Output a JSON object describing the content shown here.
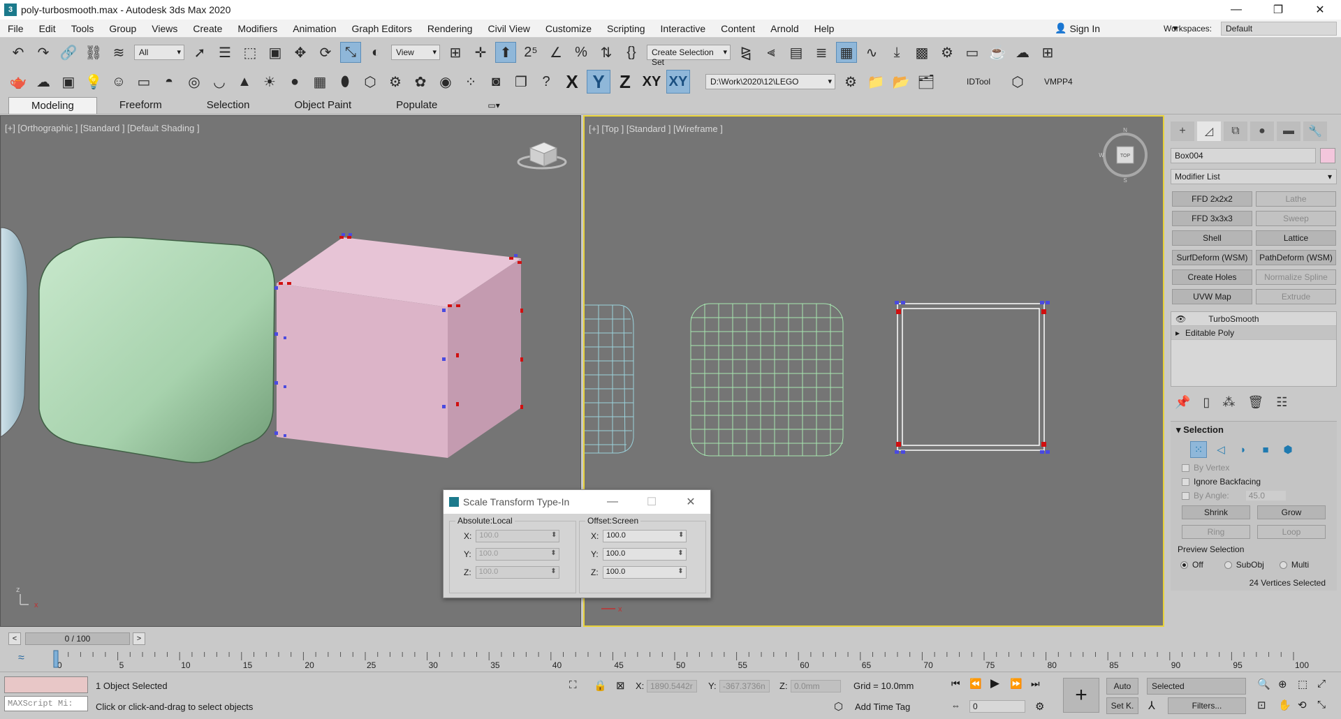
{
  "titlebar": {
    "title": "poly-turbosmooth.max - Autodesk 3ds Max 2020",
    "min": "—",
    "max": "❐",
    "close": "✕"
  },
  "menu": [
    "File",
    "Edit",
    "Tools",
    "Group",
    "Views",
    "Create",
    "Modifiers",
    "Animation",
    "Graph Editors",
    "Rendering",
    "Civil View",
    "Customize",
    "Scripting",
    "Interactive",
    "Content",
    "Arnold",
    "Help"
  ],
  "signin": "Sign In",
  "workspaces": {
    "label": "Workspaces:",
    "value": "Default"
  },
  "toolbar1": {
    "filter": "All",
    "refcoord": "View",
    "selset": "Create Selection Set"
  },
  "toolbar2": {
    "path": "D:\\Work\\2020\\12\\LEGO",
    "idtool": "IDTool",
    "vmpp": "VMPP4",
    "axis": [
      "X",
      "Y",
      "Z",
      "XY",
      "XY"
    ]
  },
  "ribbon_tabs": [
    "Modeling",
    "Freeform",
    "Selection",
    "Object Paint",
    "Populate"
  ],
  "viewport_left": {
    "label": "[+] [Orthographic ] [Standard ] [Default Shading ]"
  },
  "viewport_right": {
    "label": "[+] [Top ] [Standard ] [Wireframe ]"
  },
  "command_panel": {
    "object_name": "Box004",
    "modifier_list": "Modifier List",
    "modifiers": [
      {
        "label": "FFD 2x2x2",
        "enabled": true
      },
      {
        "label": "Lathe",
        "enabled": false
      },
      {
        "label": "FFD 3x3x3",
        "enabled": true
      },
      {
        "label": "Sweep",
        "enabled": false
      },
      {
        "label": "Shell",
        "enabled": true
      },
      {
        "label": "Lattice",
        "enabled": true
      },
      {
        "label": "SurfDeform (WSM)",
        "enabled": true
      },
      {
        "label": "PathDeform (WSM)",
        "enabled": true
      },
      {
        "label": "Create Holes",
        "enabled": true
      },
      {
        "label": "Normalize Spline",
        "enabled": false
      },
      {
        "label": "UVW Map",
        "enabled": true
      },
      {
        "label": "Extrude",
        "enabled": false
      }
    ],
    "stack": [
      "TurboSmooth",
      "Editable Poly"
    ],
    "selection": {
      "title": "Selection",
      "by_vertex": "By Vertex",
      "ignore_backfacing": "Ignore Backfacing",
      "by_angle": "By Angle:",
      "by_angle_value": "45.0",
      "shrink": "Shrink",
      "grow": "Grow",
      "ring": "Ring",
      "loop": "Loop",
      "preview": "Preview Selection",
      "preview_options": [
        "Off",
        "SubObj",
        "Multi"
      ],
      "status": "24 Vertices Selected"
    }
  },
  "dialog": {
    "title": "Scale Transform Type-In",
    "absolute": {
      "title": "Absolute:Local",
      "x": "100.0",
      "y": "100.0",
      "z": "100.0"
    },
    "offset": {
      "title": "Offset:Screen",
      "x": "100.0",
      "y": "100.0",
      "z": "100.0"
    },
    "labels": {
      "x": "X:",
      "y": "Y:",
      "z": "Z:"
    }
  },
  "timeline": {
    "position": "0 / 100",
    "ticks": [
      "0",
      "5",
      "10",
      "15",
      "20",
      "25",
      "30",
      "35",
      "40",
      "45",
      "50",
      "55",
      "60",
      "65",
      "70",
      "75",
      "80",
      "85",
      "90",
      "95",
      "100"
    ]
  },
  "status": {
    "selected": "1 Object Selected",
    "prompt": "Click or click-and-drag to select objects",
    "script": "MAXScript Mi:",
    "x_label": "X:",
    "x": "1890.5442r",
    "y_label": "Y:",
    "y": "-367.3736n",
    "z_label": "Z:",
    "z": "0.0mm",
    "grid": "Grid = 10.0mm",
    "add_time_tag": "Add Time Tag",
    "auto": "Auto",
    "selected_dropdown": "Selected",
    "setk": "Set K.",
    "filters": "Filters...",
    "frame": "0"
  }
}
